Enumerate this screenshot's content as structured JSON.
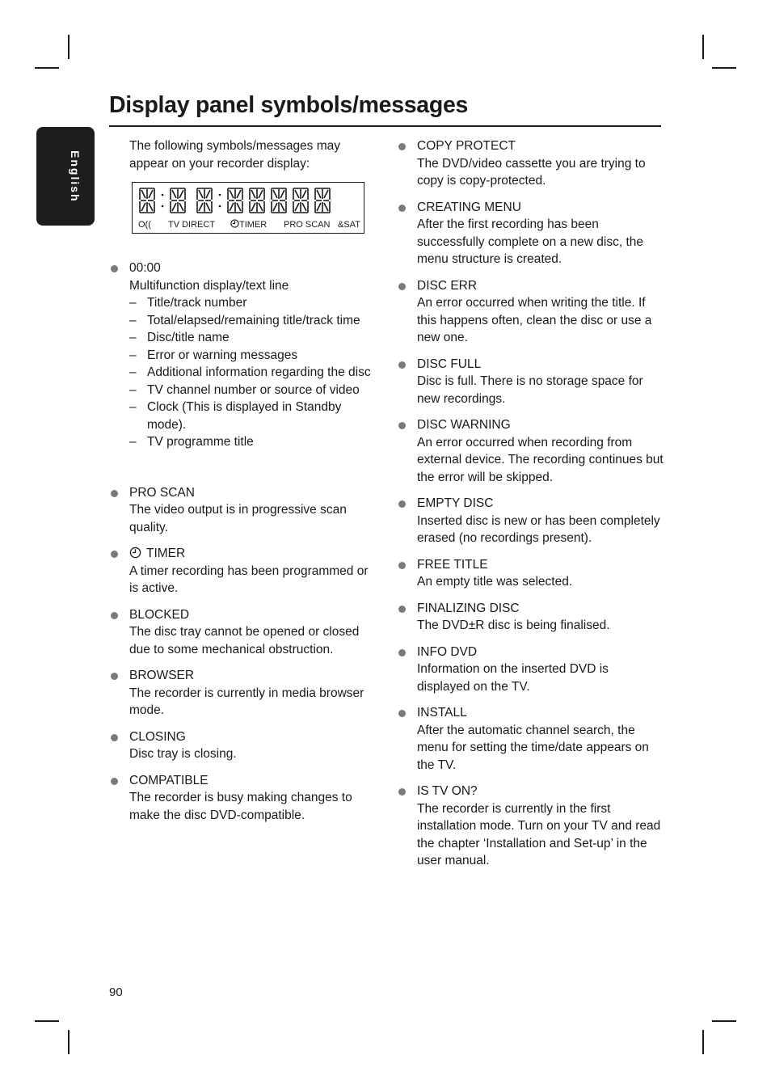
{
  "page": {
    "title": "Display panel symbols/messages",
    "language_tab": "English",
    "page_number": "90"
  },
  "intro": "The following symbols/messages may appear on your recorder display:",
  "display_panel": {
    "labels": {
      "record_icon": "O((",
      "tv_direct": "TV DIRECT",
      "timer": "TIMER",
      "pro_scan": "PRO SCAN",
      "sat": "SAT"
    },
    "icons": {
      "record": "record-signal-icon",
      "timer": "clock-icon",
      "sat": "satellite-icon"
    }
  },
  "left_entries": [
    {
      "heading": "00:00",
      "description": "Multifunction display/text line",
      "sub_items": [
        "Title/track number",
        "Total/elapsed/remaining title/track time",
        "Disc/title name",
        "Error or warning messages",
        "Additional information regarding the disc",
        "TV channel number or source of video",
        "Clock (This is displayed in Standby mode).",
        "TV programme title"
      ]
    },
    {
      "heading": "PRO SCAN",
      "description": "The video output is in progressive scan quality."
    },
    {
      "heading": "TIMER",
      "icon": "clock-icon",
      "description": "A timer recording has been programmed or is active."
    },
    {
      "heading": "BLOCKED",
      "description": "The disc tray cannot be opened or closed due to some mechanical obstruction."
    },
    {
      "heading": "BROWSER",
      "description": "The recorder is currently in media browser mode."
    },
    {
      "heading": "CLOSING",
      "description": "Disc tray is closing."
    },
    {
      "heading": "COMPATIBLE",
      "description": "The recorder is busy making changes to make the disc DVD-compatible."
    }
  ],
  "right_entries": [
    {
      "heading": "COPY PROTECT",
      "description": "The DVD/video cassette you are trying to copy is copy-protected."
    },
    {
      "heading": "CREATING MENU",
      "description": "After the first recording has been successfully complete on a new disc, the menu structure is created."
    },
    {
      "heading": "DISC ERR",
      "description": "An error occurred when writing the title. If this happens often, clean the disc or use a new one."
    },
    {
      "heading": "DISC FULL",
      "description": "Disc is full. There is no storage space for new recordings."
    },
    {
      "heading": "DISC WARNING",
      "description": "An error occurred when recording from external device. The recording continues but the error will be skipped."
    },
    {
      "heading": "EMPTY DISC",
      "description": "Inserted disc is new or has been completely erased (no recordings present)."
    },
    {
      "heading": "FREE TITLE",
      "description": "An empty title was selected."
    },
    {
      "heading": "FINALIZING DISC",
      "description": "The DVD±R disc is being finalised."
    },
    {
      "heading": "INFO DVD",
      "description": "Information on the inserted DVD is displayed on the TV."
    },
    {
      "heading": "INSTALL",
      "description": "After the automatic channel search, the menu for setting the time/date appears on the TV."
    },
    {
      "heading": "IS TV ON?",
      "description": "The recorder is currently in the first installation mode. Turn on your TV and read the chapter ‘Installation and Set-up’ in the user manual."
    }
  ]
}
